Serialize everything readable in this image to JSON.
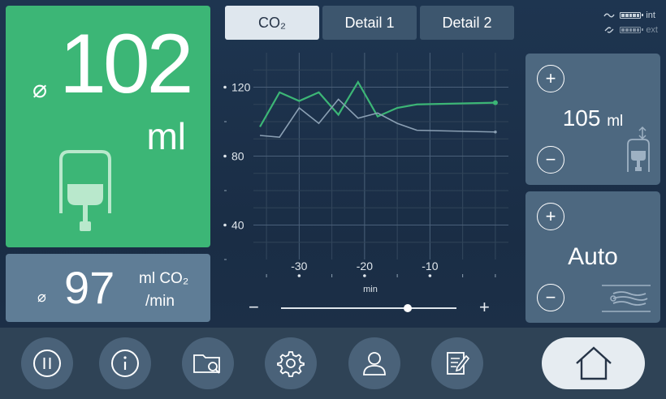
{
  "main_panel": {
    "avg_symbol": "⌀",
    "value": "102",
    "unit": "ml",
    "icon": "tidal-volume-icon",
    "color": "#3cb676"
  },
  "secondary_panel": {
    "avg_symbol": "⌀",
    "value": "97",
    "unit_line1": "ml CO₂",
    "unit_line2": "/min"
  },
  "tabs": [
    {
      "label": "CO₂",
      "active": true
    },
    {
      "label": "Detail 1",
      "active": false
    },
    {
      "label": "Detail 2",
      "active": false
    }
  ],
  "status": {
    "power_label": "int",
    "ext_label": "ext",
    "power_icon": "ac-power-icon",
    "link_icon": "link-icon"
  },
  "chart_data": {
    "type": "line",
    "xlabel": "min",
    "ylabel": "",
    "xlim": [
      -37,
      2
    ],
    "ylim": [
      20,
      140
    ],
    "x_ticks": [
      -30,
      -20,
      -10
    ],
    "y_ticks": [
      40,
      80,
      120
    ],
    "grid": true,
    "series": [
      {
        "color": "#3cb676",
        "x": [
          -36,
          -33,
          -30,
          -27,
          -24,
          -21,
          -18,
          -15,
          -12,
          0
        ],
        "values": [
          97,
          117,
          112,
          117,
          104,
          123,
          103,
          108,
          110,
          111
        ]
      },
      {
        "color": "#8a9fb3",
        "x": [
          -36,
          -33,
          -30,
          -27,
          -24,
          -21,
          -18,
          -15,
          -12,
          0
        ],
        "values": [
          92,
          91,
          108,
          99,
          113,
          102,
          105,
          99,
          95,
          94
        ]
      }
    ]
  },
  "controls": {
    "ctrl1": {
      "plus": "+",
      "minus": "−",
      "value": "105",
      "unit": "ml",
      "icon": "tidal-volume-setting-icon"
    },
    "ctrl2": {
      "plus": "+",
      "minus": "−",
      "value": "Auto",
      "icon": "flow-icon"
    }
  },
  "slider": {
    "minus": "−",
    "plus": "+",
    "level": 0.72
  },
  "toolbar": {
    "buttons": [
      "pause-icon",
      "info-icon",
      "folder-search-icon",
      "settings-icon",
      "user-icon",
      "notes-icon"
    ],
    "home": "home-icon"
  }
}
